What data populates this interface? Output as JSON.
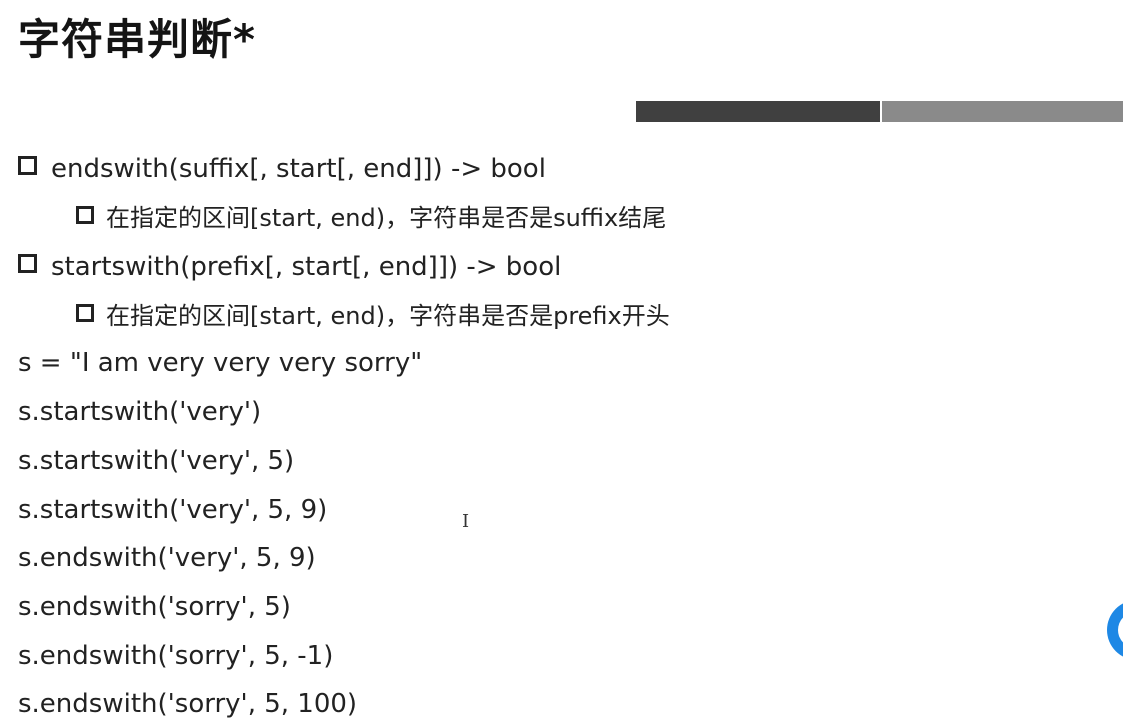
{
  "slide": {
    "title": "字符串判断*",
    "bullets": [
      {
        "text": "endswith(suffix[, start[, end]]) -> bool",
        "sub": "在指定的区间[start, end)，字符串是否是suffix结尾"
      },
      {
        "text": "startswith(prefix[, start[, end]]) -> bool",
        "sub": "在指定的区间[start, end)，字符串是否是prefix开头"
      }
    ],
    "code": [
      "s = \"I am very very very sorry\"",
      "s.startswith('very')",
      "s.startswith('very', 5)",
      "s.startswith('very', 5, 9)",
      "s.endswith('very', 5, 9)",
      "s.endswith('sorry', 5)",
      "s.endswith('sorry', 5, -1)",
      "s.endswith('sorry', 5, 100)"
    ],
    "cursor_glyph": "I",
    "colors": {
      "bar_dark": "#404040",
      "bar_light": "#8a8a8a",
      "edge_widget": "#1e88e5"
    }
  }
}
